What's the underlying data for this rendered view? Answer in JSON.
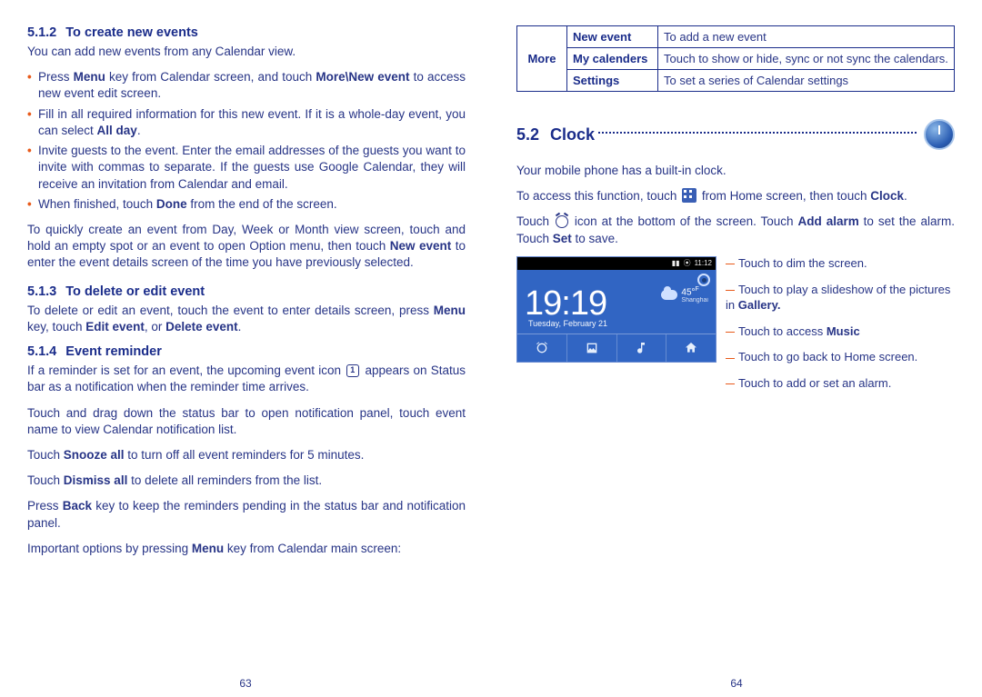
{
  "left": {
    "s512_num": "5.1.2",
    "s512_title": "To create new events",
    "s512_intro": "You can add new events from any Calendar view.",
    "s512_b1_a": "Press ",
    "s512_b1_b": "Menu",
    "s512_b1_c": " key from Calendar screen, and touch ",
    "s512_b1_d": "More\\New event",
    "s512_b1_e": " to access new event edit screen.",
    "s512_b2_a": "Fill in all required information for this new event. If it is a whole-day event, you can select ",
    "s512_b2_b": "All day",
    "s512_b2_c": ".",
    "s512_b3": "Invite guests to the event. Enter the email addresses of the guests you want to invite with commas to separate. If the guests use Google Calendar, they will receive an invitation from Calendar and email.",
    "s512_b4_a": "When finished, touch ",
    "s512_b4_b": "Done",
    "s512_b4_c": " from the end of the screen.",
    "s512_para_a": "To quickly create an event from Day, Week or Month view screen, touch and hold an empty spot or an event to open Option menu, then touch ",
    "s512_para_b": "New event",
    "s512_para_c": " to enter the event details screen of the time you have previously selected.",
    "s513_num": "5.1.3",
    "s513_title": "To delete or edit event",
    "s513_a": "To delete or edit an event, touch the event to enter details screen, press ",
    "s513_b": "Menu",
    "s513_c": " key, touch ",
    "s513_d": "Edit event",
    "s513_e": ", or ",
    "s513_f": "Delete event",
    "s513_g": ".",
    "s514_num": "5.1.4",
    "s514_title": "Event reminder",
    "s514_p1_a": "If a reminder is set for an event, the upcoming event icon ",
    "s514_p1_b": " appears on Status bar as a notification when the reminder time arrives.",
    "s514_p2": "Touch and drag down the status bar to open notification panel, touch event name to view Calendar notification list.",
    "s514_p3_a": "Touch ",
    "s514_p3_b": "Snooze all",
    "s514_p3_c": " to turn off all event reminders for 5 minutes.",
    "s514_p4_a": "Touch ",
    "s514_p4_b": "Dismiss all",
    "s514_p4_c": " to delete all reminders from the list.",
    "s514_p5_a": "Press ",
    "s514_p5_b": "Back",
    "s514_p5_c": " key to keep the reminders pending in the status bar and notification panel.",
    "s514_p6_a": "Important options by pressing ",
    "s514_p6_b": "Menu",
    "s514_p6_c": " key from Calendar main screen:",
    "page_num": "63"
  },
  "right": {
    "table": {
      "more": "More",
      "r1a": "New event",
      "r1b": "To add a new event",
      "r2a": "My calenders",
      "r2b": "Touch to show or hide, sync or not sync the calendars.",
      "r3a": "Settings",
      "r3b": "To set a series of Calendar settings"
    },
    "sec_num": "5.2",
    "sec_title": "Clock",
    "p1": "Your mobile phone has a built-in clock.",
    "p2_a": "To access this function, touch ",
    "p2_b": " from Home screen, then touch ",
    "p2_c": "Clock",
    "p2_d": ".",
    "p3_a": "Touch ",
    "p3_b": " icon at the bottom of the screen. Touch ",
    "p3_c": "Add alarm",
    "p3_d": " to set the alarm. Touch ",
    "p3_e": "Set",
    "p3_f": " to save.",
    "shot": {
      "status_time": "11:12",
      "time": "19:19",
      "date": "Tuesday, February 21",
      "temp": "45°",
      "tempunit": "F",
      "city": "Shanghai"
    },
    "annot": {
      "a1": "Touch to dim the screen.",
      "a2_a": "Touch to play a slideshow of the pictures in ",
      "a2_b": "Gallery.",
      "a3_a": "Touch to access ",
      "a3_b": "Music",
      "a4": "Touch to go back to Home screen.",
      "a5": "Touch to add or set an alarm."
    },
    "page_num": "64"
  }
}
